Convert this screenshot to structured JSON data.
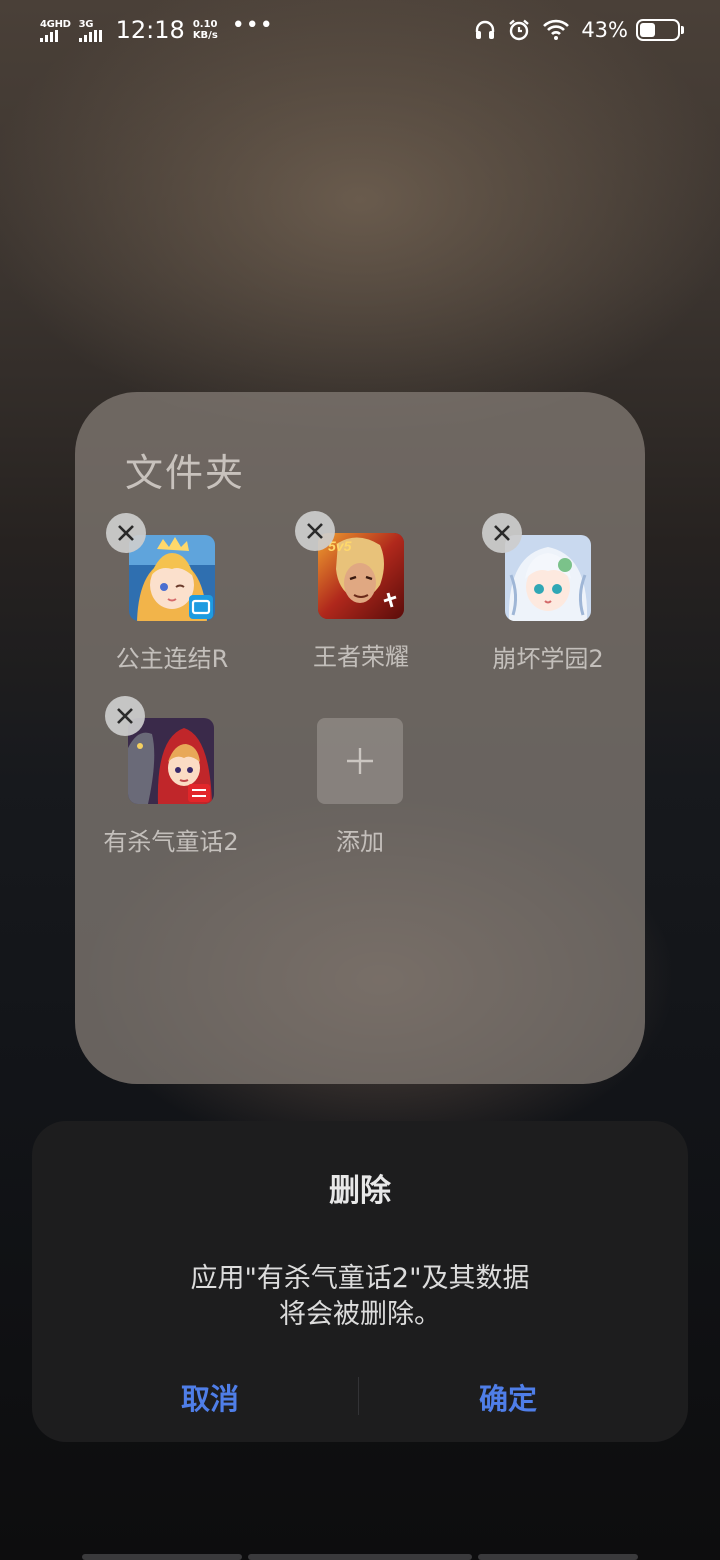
{
  "status_bar": {
    "network1": "4GHD",
    "network2": "3G",
    "time": "12:18",
    "speed_value": "0.10",
    "speed_unit": "KB/s",
    "more": "•••",
    "battery_percent": "43%",
    "battery_level": 0.43,
    "icons": [
      "headphones-icon",
      "alarm-icon",
      "wifi-icon",
      "battery-icon"
    ]
  },
  "folder": {
    "title": "文件夹",
    "apps": [
      {
        "label": "公主连结R",
        "icon": "princess-connect-icon",
        "removable": true
      },
      {
        "label": "王者荣耀",
        "icon": "honor-of-kings-icon",
        "removable": true
      },
      {
        "label": "崩坏学园2",
        "icon": "honkai-gakuen-2-icon",
        "removable": true
      },
      {
        "label": "有杀气童话2",
        "icon": "murderous-fairy-tale-2-icon",
        "removable": true
      }
    ],
    "add_label": "添加"
  },
  "dialog": {
    "title": "删除",
    "message_line1": "应用\"有杀气童话2\"及其数据",
    "message_line2": "将会被删除。",
    "cancel_label": "取消",
    "confirm_label": "确定",
    "accent_color": "#4f7ee8"
  }
}
